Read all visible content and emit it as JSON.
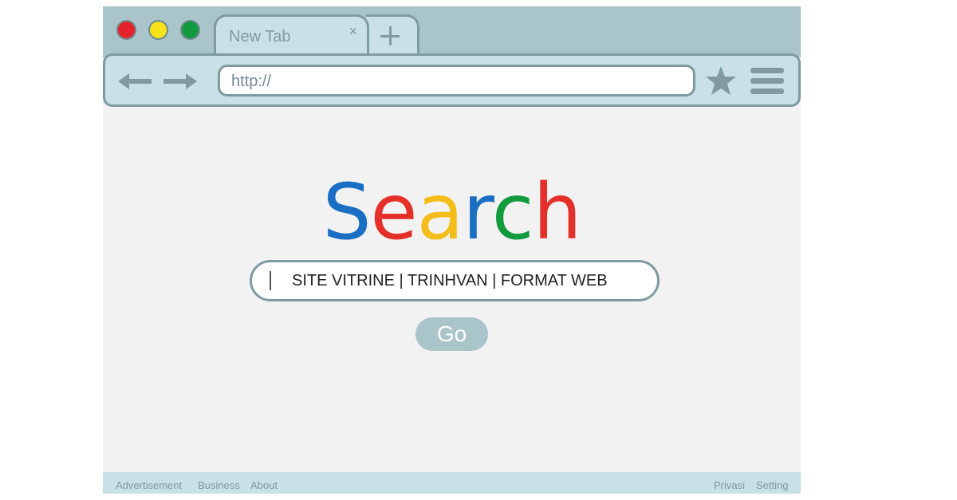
{
  "window": {
    "controls": {
      "close_color": "#e5212a",
      "minimize_color": "#f6e11a",
      "maximize_color": "#119a3e"
    }
  },
  "tab": {
    "label": "New Tab",
    "close_symbol": "×",
    "new_tab_icon": "plus-icon"
  },
  "toolbar": {
    "back_icon": "back-arrow-icon",
    "forward_icon": "forward-arrow-icon",
    "url": "http://",
    "bookmark_icon": "star-icon",
    "menu_icon": "hamburger-menu-icon"
  },
  "logo": {
    "letters": [
      {
        "char": "S",
        "color": "#1a6fc4"
      },
      {
        "char": "e",
        "color": "#e5302a"
      },
      {
        "char": "a",
        "color": "#f5bd1a"
      },
      {
        "char": "r",
        "color": "#1a6fc4"
      },
      {
        "char": "c",
        "color": "#119a3e"
      },
      {
        "char": "h",
        "color": "#e5302a"
      }
    ]
  },
  "search": {
    "value": "SITE VITRINE | TRINHVAN | FORMAT WEB"
  },
  "go_button": {
    "label": "Go"
  },
  "footer": {
    "left_links": [
      "Advertisement",
      "Business",
      "About"
    ],
    "right_links": [
      "Privasi",
      "Setting"
    ]
  },
  "colors": {
    "chrome_bg": "#a9c5ca",
    "toolbar_bg": "#c8e0e6",
    "border": "#7f9aa0",
    "page_bg": "#f2f2f2"
  }
}
